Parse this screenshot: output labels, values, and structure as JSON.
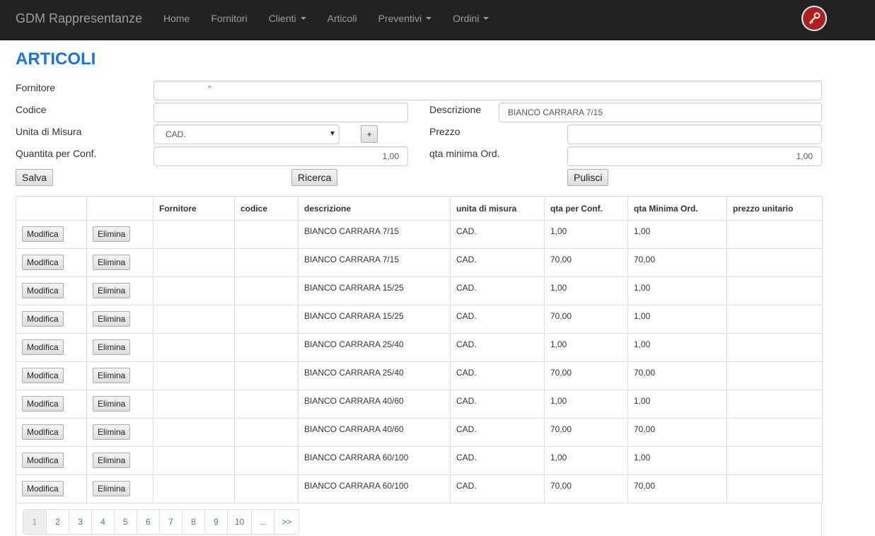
{
  "navbar": {
    "brand": "GDM Rappresentanze",
    "items": [
      {
        "label": "Home",
        "dropdown": false
      },
      {
        "label": "Fornitori",
        "dropdown": false
      },
      {
        "label": "Clienti",
        "dropdown": true
      },
      {
        "label": "Articoli",
        "dropdown": false
      },
      {
        "label": "Preventivi",
        "dropdown": true
      },
      {
        "label": "Ordini",
        "dropdown": true
      }
    ],
    "user_icon": "key-icon"
  },
  "page_title": "ARTICOLI",
  "form": {
    "fornitore_label": "Fornitore",
    "fornitore_value": "^",
    "codice_label": "Codice",
    "codice_value": "",
    "descrizione_label": "Descrizione",
    "descrizione_value": "BIANCO CARRARA 7/15",
    "unita_label": "Unita di Misura",
    "unita_value": "CAD.",
    "add_unit_label": "+",
    "prezzo_label": "Prezzo",
    "prezzo_value": "",
    "qta_conf_label": "Quantita per Conf.",
    "qta_conf_value": "1,00",
    "qta_min_label": "qta minima Ord.",
    "qta_min_value": "1,00",
    "salva_label": "Salva",
    "ricerca_label": "Ricerca",
    "pulisci_label": "Pulisci"
  },
  "table": {
    "headers": [
      "",
      "",
      "Fornitore",
      "codice",
      "descrizione",
      "unita di misura",
      "qta per Conf.",
      "qta Minima Ord.",
      "prezzo unitario"
    ],
    "modifica_label": "Modifica",
    "elimina_label": "Elimina",
    "rows": [
      {
        "fornitore": "",
        "codice": "",
        "descrizione": "BIANCO CARRARA 7/15",
        "unita": "CAD.",
        "qta_conf": "1,00",
        "qta_min": "1,00",
        "prezzo": ""
      },
      {
        "fornitore": "",
        "codice": "",
        "descrizione": "BIANCO CARRARA 7/15",
        "unita": "CAD.",
        "qta_conf": "70,00",
        "qta_min": "70,00",
        "prezzo": ""
      },
      {
        "fornitore": "",
        "codice": "",
        "descrizione": "BIANCO CARRARA 15/25",
        "unita": "CAD.",
        "qta_conf": "1,00",
        "qta_min": "1,00",
        "prezzo": ""
      },
      {
        "fornitore": "",
        "codice": "",
        "descrizione": "BIANCO CARRARA 15/25",
        "unita": "CAD.",
        "qta_conf": "70,00",
        "qta_min": "1,00",
        "prezzo": ""
      },
      {
        "fornitore": "",
        "codice": "",
        "descrizione": "BIANCO CARRARA 25/40",
        "unita": "CAD.",
        "qta_conf": "1,00",
        "qta_min": "1,00",
        "prezzo": ""
      },
      {
        "fornitore": "",
        "codice": "",
        "descrizione": "BIANCO CARRARA 25/40",
        "unita": "CAD.",
        "qta_conf": "70,00",
        "qta_min": "70,00",
        "prezzo": ""
      },
      {
        "fornitore": "",
        "codice": "",
        "descrizione": "BIANCO CARRARA 40/60",
        "unita": "CAD.",
        "qta_conf": "1,00",
        "qta_min": "1,00",
        "prezzo": ""
      },
      {
        "fornitore": "",
        "codice": "",
        "descrizione": "BIANCO CARRARA 40/60",
        "unita": "CAD.",
        "qta_conf": "70,00",
        "qta_min": "70,00",
        "prezzo": ""
      },
      {
        "fornitore": "",
        "codice": "",
        "descrizione": "BIANCO CARRARA 60/100",
        "unita": "CAD.",
        "qta_conf": "1,00",
        "qta_min": "1,00",
        "prezzo": ""
      },
      {
        "fornitore": "",
        "codice": "",
        "descrizione": "BIANCO CARRARA 60/100",
        "unita": "CAD.",
        "qta_conf": "70,00",
        "qta_min": "70,00",
        "prezzo": ""
      }
    ]
  },
  "pagination": [
    "1",
    "2",
    "3",
    "4",
    "5",
    "6",
    "7",
    "8",
    "9",
    "10",
    "...",
    ">>"
  ],
  "colors": {
    "navbar_bg": "#222222",
    "title": "#1a73d9",
    "link": "#337ab7"
  }
}
